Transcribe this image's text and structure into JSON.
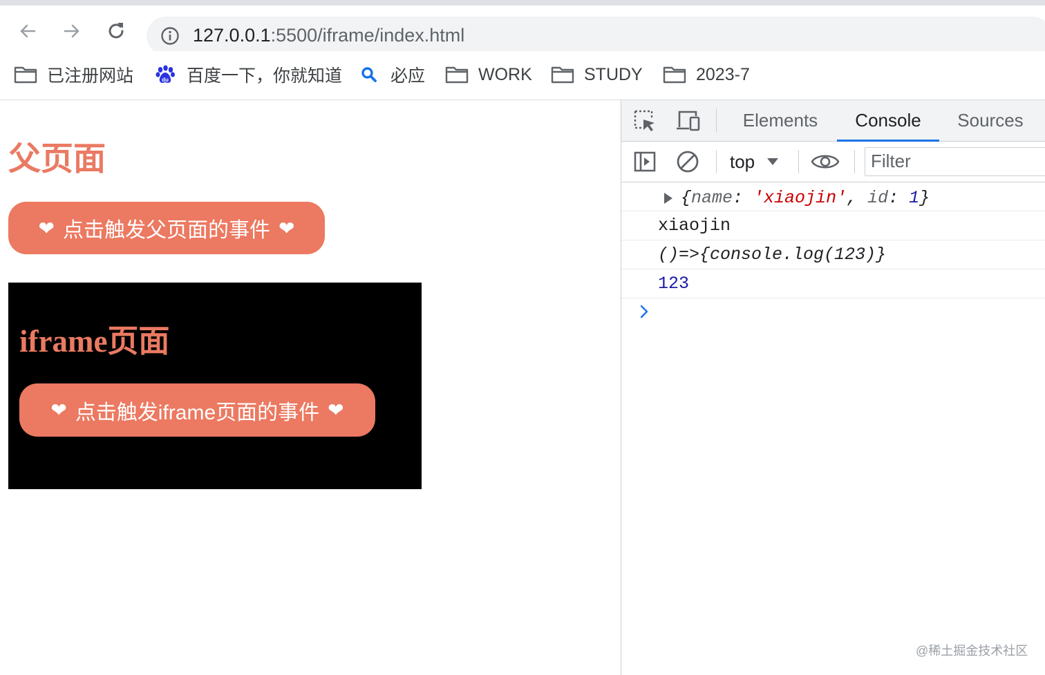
{
  "browser": {
    "url_host": "127.0.0.1",
    "url_port_path": ":5500/iframe/index.html",
    "bookmarks": [
      {
        "icon": "folder-icon",
        "label": "已注册网站"
      },
      {
        "icon": "baidu-paw-icon",
        "label": "百度一下，你就知道"
      },
      {
        "icon": "search-icon",
        "label": "必应"
      },
      {
        "icon": "folder-icon",
        "label": "WORK"
      },
      {
        "icon": "folder-icon",
        "label": "STUDY"
      },
      {
        "icon": "folder-icon",
        "label": "2023-7"
      }
    ]
  },
  "page": {
    "title": "父页面",
    "parent_button": {
      "label": "点击触发父页面的事件",
      "heart": "❤"
    },
    "iframe": {
      "title": "iframe页面",
      "button": {
        "label": "点击触发iframe页面的事件",
        "heart": "❤"
      }
    }
  },
  "devtools": {
    "tabs": [
      "Elements",
      "Console",
      "Sources"
    ],
    "active_tab": "Console",
    "context": "top",
    "filter_placeholder": "Filter",
    "console": {
      "object_row": {
        "open": "{",
        "key1": "name",
        "colon": ": ",
        "val1": "'xiaojin'",
        "comma": ", ",
        "key2": "id",
        "val2": "1",
        "close": "}"
      },
      "rows": [
        "xiaojin",
        "()=>{console.log(123)}",
        "123"
      ]
    }
  },
  "watermark": "@稀土掘金技术社区",
  "colors": {
    "accent": "#ec7961",
    "devtools_blue": "#1a73e8",
    "string_red": "#c80000",
    "number_blue": "#1a1aa6"
  }
}
